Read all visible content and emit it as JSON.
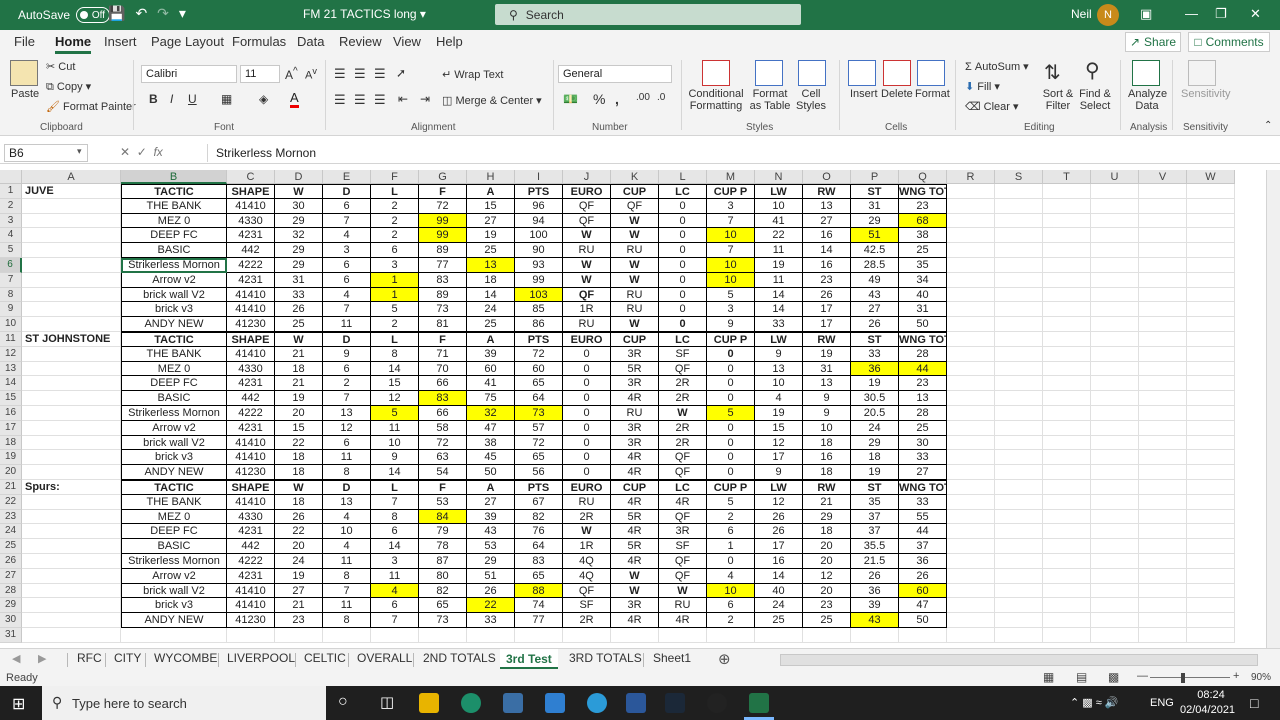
{
  "titlebar": {
    "autosave_label": "AutoSave",
    "autosave_state": "Off",
    "doc_title": "FM 21 TACTICS long",
    "search_placeholder": "Search",
    "user_name": "Neil",
    "user_initial": "N"
  },
  "ribbon_tabs": [
    "File",
    "Home",
    "Insert",
    "Page Layout",
    "Formulas",
    "Data",
    "Review",
    "View",
    "Help"
  ],
  "ribbon_active_tab": "Home",
  "share_label": "Share",
  "comments_label": "Comments",
  "ribbon": {
    "clipboard": {
      "paste": "Paste",
      "cut": "Cut",
      "copy": "Copy",
      "format_painter": "Format Painter",
      "label": "Clipboard"
    },
    "font": {
      "name": "Calibri",
      "size": "11",
      "label": "Font"
    },
    "alignment": {
      "wrap": "Wrap Text",
      "merge": "Merge & Center",
      "label": "Alignment"
    },
    "number": {
      "format": "General",
      "label": "Number"
    },
    "styles": {
      "conditional": "Conditional Formatting",
      "format_table": "Format as Table",
      "cell_styles": "Cell Styles",
      "label": "Styles"
    },
    "cells": {
      "insert": "Insert",
      "delete": "Delete",
      "format": "Format",
      "label": "Cells"
    },
    "editing": {
      "autosum": "AutoSum",
      "fill": "Fill",
      "clear": "Clear",
      "sort": "Sort & Filter",
      "find": "Find & Select",
      "label": "Editing"
    },
    "analysis": {
      "analyze": "Analyze Data",
      "label": "Analysis"
    },
    "sensitivity": {
      "sensitivity": "Sensitivity",
      "label": "Sensitivity"
    }
  },
  "formula_bar": {
    "name_box": "B6",
    "formula": "Strikerless Mornon"
  },
  "columns": [
    "A",
    "B",
    "C",
    "D",
    "E",
    "F",
    "G",
    "H",
    "I",
    "J",
    "K",
    "L",
    "M",
    "N",
    "O",
    "P",
    "Q",
    "R",
    "S",
    "T",
    "U",
    "V",
    "W"
  ],
  "col_widths": [
    99,
    106,
    48,
    48,
    48,
    48,
    48,
    48,
    48,
    48,
    48,
    48,
    48,
    48,
    48,
    48,
    48,
    48,
    48,
    48,
    48,
    48,
    48
  ],
  "row_numbers": [
    1,
    2,
    3,
    4,
    5,
    6,
    7,
    8,
    9,
    10,
    11,
    12,
    13,
    14,
    15,
    16,
    17,
    18,
    19,
    20,
    21,
    22,
    23,
    24,
    25,
    26,
    27,
    28,
    29,
    30,
    31
  ],
  "sheet": {
    "rows": [
      [
        "JUVE",
        "TACTIC",
        "SHAPE",
        "W",
        "D",
        "L",
        "F",
        "A",
        "PTS",
        "EURO",
        "CUP",
        "LC",
        "CUP P",
        "LW",
        "RW",
        "ST",
        "WNG TOTAL"
      ],
      [
        "",
        "THE BANK",
        "41410",
        "30",
        "6",
        "2",
        "72",
        "15",
        "96",
        "QF",
        "QF",
        "0",
        "3",
        "10",
        "13",
        "31",
        "23"
      ],
      [
        "",
        "MEZ 0",
        "4330",
        "29",
        "7",
        "2",
        "99",
        "27",
        "94",
        "QF",
        "W",
        "0",
        "7",
        "41",
        "27",
        "29",
        "68"
      ],
      [
        "",
        "DEEP FC",
        "4231",
        "32",
        "4",
        "2",
        "99",
        "19",
        "100",
        "W",
        "W",
        "0",
        "10",
        "22",
        "16",
        "51",
        "38"
      ],
      [
        "",
        "BASIC",
        "442",
        "29",
        "3",
        "6",
        "89",
        "25",
        "90",
        "RU",
        "RU",
        "0",
        "7",
        "11",
        "14",
        "42.5",
        "25"
      ],
      [
        "",
        "Strikerless Mornon",
        "4222",
        "29",
        "6",
        "3",
        "77",
        "13",
        "93",
        "W",
        "W",
        "0",
        "10",
        "19",
        "16",
        "28.5",
        "35"
      ],
      [
        "",
        "Arrow v2",
        "4231",
        "31",
        "6",
        "1",
        "83",
        "18",
        "99",
        "W",
        "W",
        "0",
        "10",
        "11",
        "23",
        "49",
        "34"
      ],
      [
        "",
        "brick wall V2",
        "41410",
        "33",
        "4",
        "1",
        "89",
        "14",
        "103",
        "QF",
        "RU",
        "0",
        "5",
        "14",
        "26",
        "43",
        "40"
      ],
      [
        "",
        "brick v3",
        "41410",
        "26",
        "7",
        "5",
        "73",
        "24",
        "85",
        "1R",
        "RU",
        "0",
        "3",
        "14",
        "17",
        "27",
        "31"
      ],
      [
        "",
        "ANDY NEW",
        "41230",
        "25",
        "11",
        "2",
        "81",
        "25",
        "86",
        "RU",
        "W",
        "0",
        "9",
        "33",
        "17",
        "26",
        "50"
      ],
      [
        "ST JOHNSTONE",
        "TACTIC",
        "SHAPE",
        "W",
        "D",
        "L",
        "F",
        "A",
        "PTS",
        "EURO",
        "CUP",
        "LC",
        "CUP P",
        "LW",
        "RW",
        "ST",
        "WNG TOTAL"
      ],
      [
        "",
        "THE BANK",
        "41410",
        "21",
        "9",
        "8",
        "71",
        "39",
        "72",
        "0",
        "3R",
        "SF",
        "0",
        "9",
        "19",
        "33",
        "28"
      ],
      [
        "",
        "MEZ 0",
        "4330",
        "18",
        "6",
        "14",
        "70",
        "60",
        "60",
        "0",
        "5R",
        "QF",
        "0",
        "13",
        "31",
        "36",
        "44"
      ],
      [
        "",
        "DEEP FC",
        "4231",
        "21",
        "2",
        "15",
        "66",
        "41",
        "65",
        "0",
        "3R",
        "2R",
        "0",
        "10",
        "13",
        "19",
        "23"
      ],
      [
        "",
        "BASIC",
        "442",
        "19",
        "7",
        "12",
        "83",
        "75",
        "64",
        "0",
        "4R",
        "2R",
        "0",
        "4",
        "9",
        "30.5",
        "13"
      ],
      [
        "",
        "Strikerless Mornon",
        "4222",
        "20",
        "13",
        "5",
        "66",
        "32",
        "73",
        "0",
        "RU",
        "W",
        "5",
        "19",
        "9",
        "20.5",
        "28"
      ],
      [
        "",
        "Arrow v2",
        "4231",
        "15",
        "12",
        "11",
        "58",
        "47",
        "57",
        "0",
        "3R",
        "2R",
        "0",
        "15",
        "10",
        "24",
        "25"
      ],
      [
        "",
        "brick wall V2",
        "41410",
        "22",
        "6",
        "10",
        "72",
        "38",
        "72",
        "0",
        "3R",
        "2R",
        "0",
        "12",
        "18",
        "29",
        "30"
      ],
      [
        "",
        "brick v3",
        "41410",
        "18",
        "11",
        "9",
        "63",
        "45",
        "65",
        "0",
        "4R",
        "QF",
        "0",
        "17",
        "16",
        "18",
        "33"
      ],
      [
        "",
        "ANDY NEW",
        "41230",
        "18",
        "8",
        "14",
        "54",
        "50",
        "56",
        "0",
        "4R",
        "QF",
        "0",
        "9",
        "18",
        "19",
        "27"
      ],
      [
        "Spurs:",
        "TACTIC",
        "SHAPE",
        "W",
        "D",
        "L",
        "F",
        "A",
        "PTS",
        "EURO",
        "CUP",
        "LC",
        "CUP P",
        "LW",
        "RW",
        "ST",
        "WNG TOTAL"
      ],
      [
        "",
        "THE BANK",
        "41410",
        "18",
        "13",
        "7",
        "53",
        "27",
        "67",
        "RU",
        "4R",
        "4R",
        "5",
        "12",
        "21",
        "35",
        "33"
      ],
      [
        "",
        "MEZ 0",
        "4330",
        "26",
        "4",
        "8",
        "84",
        "39",
        "82",
        "2R",
        "5R",
        "QF",
        "2",
        "26",
        "29",
        "37",
        "55"
      ],
      [
        "",
        "DEEP FC",
        "4231",
        "22",
        "10",
        "6",
        "79",
        "43",
        "76",
        "W",
        "4R",
        "3R",
        "6",
        "26",
        "18",
        "37",
        "44"
      ],
      [
        "",
        "BASIC",
        "442",
        "20",
        "4",
        "14",
        "78",
        "53",
        "64",
        "1R",
        "5R",
        "SF",
        "1",
        "17",
        "20",
        "35.5",
        "37"
      ],
      [
        "",
        "Strikerless Mornon",
        "4222",
        "24",
        "11",
        "3",
        "87",
        "29",
        "83",
        "4Q",
        "4R",
        "QF",
        "0",
        "16",
        "20",
        "21.5",
        "36"
      ],
      [
        "",
        "Arrow v2",
        "4231",
        "19",
        "8",
        "11",
        "80",
        "51",
        "65",
        "4Q",
        "W",
        "QF",
        "4",
        "14",
        "12",
        "26",
        "26"
      ],
      [
        "",
        "brick wall V2",
        "41410",
        "27",
        "7",
        "4",
        "82",
        "26",
        "88",
        "QF",
        "W",
        "W",
        "10",
        "40",
        "20",
        "36",
        "60"
      ],
      [
        "",
        "brick v3",
        "41410",
        "21",
        "11",
        "6",
        "65",
        "22",
        "74",
        "SF",
        "3R",
        "RU",
        "6",
        "24",
        "23",
        "39",
        "47"
      ],
      [
        "",
        "ANDY NEW",
        "41230",
        "23",
        "8",
        "7",
        "73",
        "33",
        "77",
        "2R",
        "4R",
        "4R",
        "2",
        "25",
        "25",
        "43",
        "50"
      ]
    ],
    "highlight_color": "#ffff00",
    "highlights": [
      "2,6",
      "2,16",
      "3,6",
      "3,12",
      "3,15",
      "5,7",
      "5,12",
      "6,5",
      "6,12",
      "7,5",
      "7,8",
      "12,15",
      "12,16",
      "14,6",
      "15,5",
      "15,7",
      "15,8",
      "15,12",
      "22,6",
      "27,5",
      "27,8",
      "27,12",
      "27,16",
      "28,7",
      "29,15"
    ],
    "bold_cells": [
      "2,10",
      "3,9",
      "3,10",
      "5,9",
      "5,10",
      "6,9",
      "6,10",
      "7,9",
      "9,10",
      "9,11",
      "11,12",
      "15,11",
      "23,9",
      "26,10",
      "27,10",
      "27,11"
    ]
  },
  "sheet_tabs": [
    "RFC",
    "CITY",
    "WYCOMBE",
    "LIVERPOOL",
    "CELTIC",
    "OVERALL",
    "2ND TOTALS",
    "3rd Test",
    "3RD TOTALS",
    "Sheet1"
  ],
  "active_sheet": "3rd Test",
  "status": {
    "ready": "Ready",
    "zoom": "90%"
  },
  "taskbar": {
    "search_placeholder": "Type here to search",
    "lang": "ENG",
    "time": "08:24",
    "date": "02/04/2021"
  },
  "colors": {
    "excel_green": "#217346",
    "highlight": "#ffff00"
  }
}
